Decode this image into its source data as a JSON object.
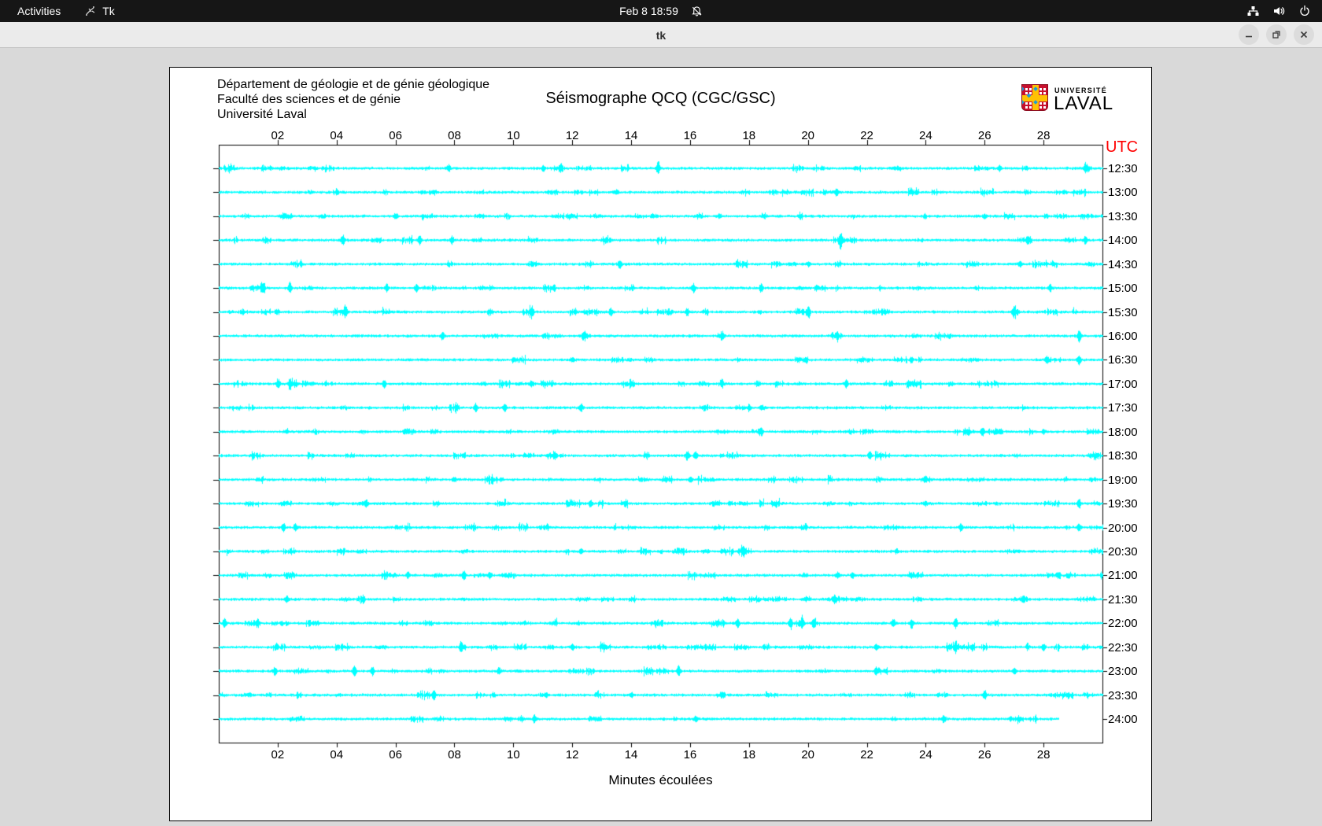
{
  "top_bar": {
    "activities_label": "Activities",
    "app_name": "Tk",
    "clock": "Feb 8 18:59",
    "icons": [
      "tk-app",
      "notifications-disabled-bell",
      "wired-network",
      "volume",
      "power"
    ]
  },
  "titlebar": {
    "title": "tk",
    "buttons": [
      "minimize",
      "maximize",
      "close"
    ]
  },
  "chart": {
    "header_lines": [
      "Département de géologie et de génie géologique",
      "Faculté des sciences et de génie",
      "Université Laval"
    ],
    "title": "Séismographe QCQ (CGC/GSC)",
    "logo": {
      "line1": "UNIVERSITÉ",
      "line2": "LAVAL"
    },
    "utc_label": "UTC",
    "xlabel": "Minutes écoulées",
    "colors": {
      "trace": "#00ffff",
      "utc_label": "#ff0000",
      "axis": "#000000",
      "logo_red": "#c8102e",
      "logo_yellow": "#ffc103",
      "logo_blue": "#1e9cd7"
    }
  },
  "chart_data": {
    "type": "line",
    "subtype": "seismogram-helicorder",
    "title": "Séismographe QCQ (CGC/GSC)",
    "xlabel": "Minutes écoulées",
    "right_axis_label": "UTC",
    "x_range_minutes": [
      0,
      30
    ],
    "x_ticks": [
      "02",
      "04",
      "06",
      "08",
      "10",
      "12",
      "14",
      "16",
      "18",
      "20",
      "22",
      "24",
      "26",
      "28"
    ],
    "trace_color": "#00ffff",
    "rows": [
      {
        "utc": "12:30",
        "spikes": [
          [
            7.8,
            4
          ],
          [
            11.0,
            3
          ],
          [
            11.6,
            4
          ],
          [
            14.9,
            9
          ],
          [
            26.5,
            3
          ],
          [
            29.4,
            7
          ]
        ]
      },
      {
        "utc": "13:00",
        "spikes": [
          [
            4.0,
            3
          ],
          [
            13.5,
            3
          ],
          [
            21.0,
            3
          ]
        ]
      },
      {
        "utc": "13:30",
        "spikes": [
          [
            6.0,
            3
          ],
          [
            17.0,
            3
          ],
          [
            26.0,
            3
          ]
        ]
      },
      {
        "utc": "14:00",
        "spikes": [
          [
            4.2,
            7
          ],
          [
            6.8,
            6
          ],
          [
            7.9,
            5
          ],
          [
            21.1,
            8
          ],
          [
            27.5,
            4
          ],
          [
            29.4,
            5
          ]
        ]
      },
      {
        "utc": "14:30",
        "spikes": [
          [
            13.6,
            6
          ],
          [
            20.0,
            3
          ],
          [
            27.2,
            4
          ]
        ]
      },
      {
        "utc": "15:00",
        "spikes": [
          [
            1.5,
            6
          ],
          [
            2.4,
            7
          ],
          [
            5.7,
            5
          ],
          [
            6.7,
            5
          ],
          [
            16.1,
            6
          ],
          [
            18.4,
            6
          ],
          [
            28.2,
            5
          ]
        ]
      },
      {
        "utc": "15:30",
        "spikes": [
          [
            4.3,
            7
          ],
          [
            10.6,
            6
          ],
          [
            13.3,
            5
          ],
          [
            15.9,
            5
          ],
          [
            20.0,
            4
          ],
          [
            27.0,
            6
          ]
        ]
      },
      {
        "utc": "16:00",
        "spikes": [
          [
            7.6,
            5
          ],
          [
            12.4,
            5
          ],
          [
            17.1,
            6
          ],
          [
            21.0,
            4
          ],
          [
            29.2,
            8
          ]
        ]
      },
      {
        "utc": "16:30",
        "spikes": [
          [
            12.0,
            3
          ],
          [
            23.5,
            4
          ],
          [
            28.1,
            5
          ],
          [
            29.2,
            6
          ]
        ]
      },
      {
        "utc": "17:00",
        "spikes": [
          [
            2.0,
            6
          ],
          [
            2.4,
            5
          ],
          [
            5.6,
            5
          ],
          [
            10.6,
            4
          ],
          [
            21.3,
            5
          ]
        ]
      },
      {
        "utc": "17:30",
        "spikes": [
          [
            8.7,
            5
          ],
          [
            9.7,
            5
          ],
          [
            12.3,
            5
          ],
          [
            18.0,
            3
          ]
        ]
      },
      {
        "utc": "18:00",
        "spikes": [
          [
            18.4,
            4
          ],
          [
            25.9,
            5
          ],
          [
            28.0,
            3
          ]
        ]
      },
      {
        "utc": "18:30",
        "spikes": [
          [
            11.4,
            4
          ],
          [
            15.9,
            6
          ],
          [
            16.2,
            5
          ],
          [
            22.1,
            5
          ]
        ]
      },
      {
        "utc": "19:00",
        "spikes": [
          [
            8.0,
            3
          ],
          [
            16.0,
            3
          ],
          [
            24.0,
            3
          ]
        ]
      },
      {
        "utc": "19:30",
        "spikes": [
          [
            5.0,
            5
          ],
          [
            12.6,
            5
          ],
          [
            24.0,
            3
          ],
          [
            29.2,
            6
          ]
        ]
      },
      {
        "utc": "20:00",
        "spikes": [
          [
            2.2,
            5
          ],
          [
            2.6,
            4
          ],
          [
            25.2,
            5
          ],
          [
            29.2,
            5
          ]
        ]
      },
      {
        "utc": "20:30",
        "spikes": [
          [
            12.3,
            4
          ],
          [
            17.8,
            4
          ],
          [
            23.0,
            3
          ]
        ]
      },
      {
        "utc": "21:00",
        "spikes": [
          [
            6.4,
            4
          ],
          [
            8.3,
            6
          ],
          [
            9.2,
            5
          ],
          [
            21.0,
            4
          ],
          [
            21.5,
            4
          ],
          [
            28.5,
            3
          ]
        ]
      },
      {
        "utc": "21:30",
        "spikes": [
          [
            2.3,
            4
          ],
          [
            20.9,
            6
          ],
          [
            27.3,
            5
          ]
        ]
      },
      {
        "utc": "22:00",
        "spikes": [
          [
            0.2,
            6
          ],
          [
            1.3,
            5
          ],
          [
            17.6,
            6
          ],
          [
            19.4,
            6
          ],
          [
            19.8,
            7
          ],
          [
            20.2,
            6
          ],
          [
            22.9,
            5
          ],
          [
            23.5,
            6
          ],
          [
            25.0,
            6
          ]
        ]
      },
      {
        "utc": "22:30",
        "spikes": [
          [
            8.2,
            5
          ],
          [
            12.0,
            4
          ],
          [
            22.3,
            4
          ],
          [
            25.0,
            5
          ],
          [
            28.0,
            4
          ]
        ]
      },
      {
        "utc": "23:00",
        "spikes": [
          [
            1.9,
            5
          ],
          [
            4.6,
            7
          ],
          [
            5.2,
            6
          ],
          [
            9.5,
            4
          ],
          [
            15.6,
            7
          ],
          [
            22.3,
            5
          ],
          [
            27.0,
            4
          ]
        ]
      },
      {
        "utc": "23:30",
        "spikes": [
          [
            7.3,
            6
          ],
          [
            14.0,
            3
          ],
          [
            26.0,
            6
          ]
        ]
      },
      {
        "utc": "24:00",
        "spikes": [
          [
            10.7,
            5
          ],
          [
            16.2,
            4
          ],
          [
            24.6,
            5
          ]
        ],
        "end_minute": 28.5
      }
    ]
  }
}
